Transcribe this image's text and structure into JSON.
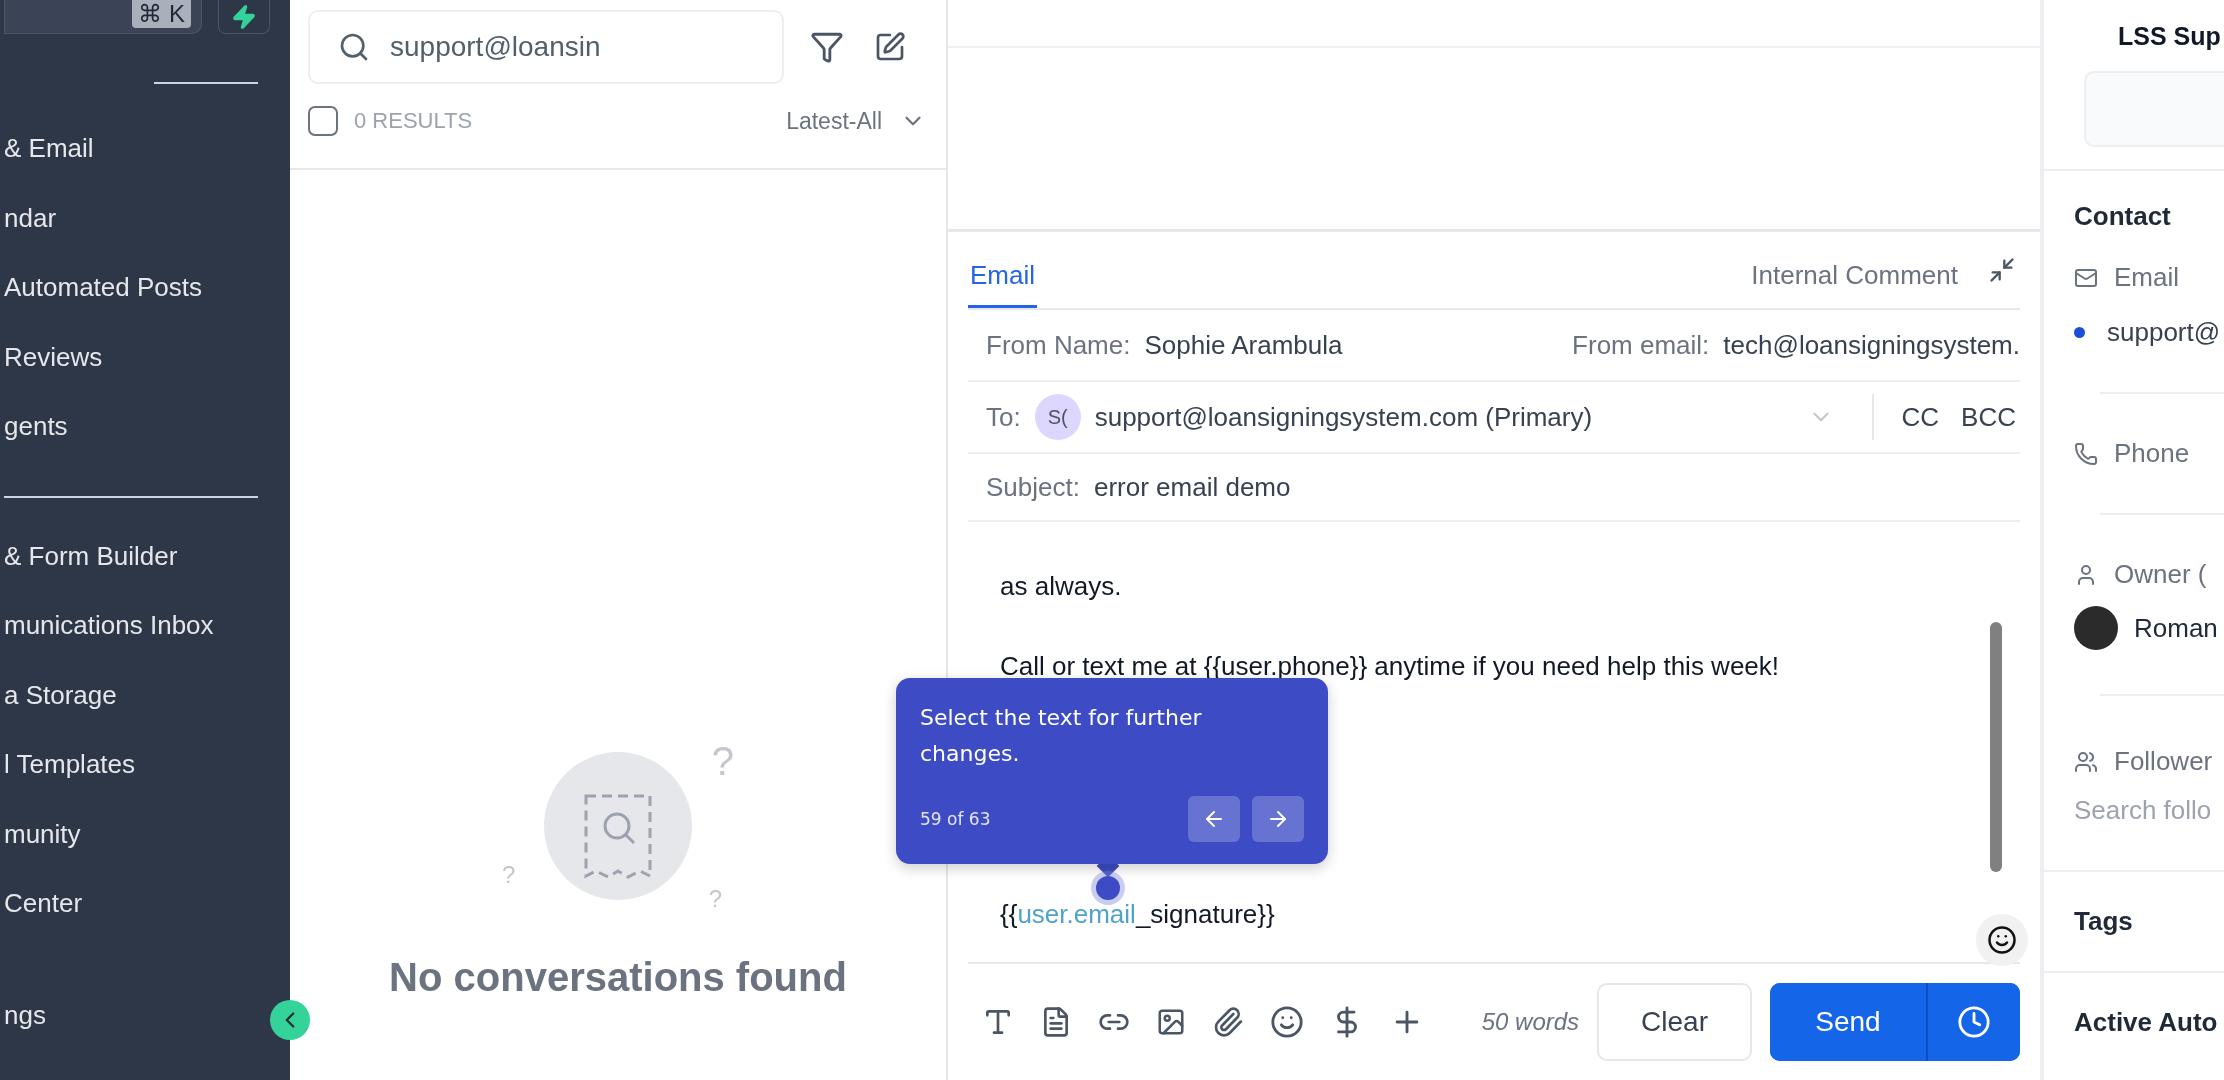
{
  "sidebar": {
    "shortcut": "⌘ K",
    "groups": [
      [
        "& Email",
        "ndar",
        "Automated Posts",
        "Reviews",
        "gents"
      ],
      [
        "& Form Builder",
        "munications Inbox",
        "a Storage",
        "l Templates",
        "munity",
        "Center"
      ],
      [
        "ngs"
      ]
    ]
  },
  "conversations": {
    "search": {
      "value": "support@loansin"
    },
    "select_all": {
      "checked": false
    },
    "results": "0 RESULTS",
    "sort": "Latest-All",
    "empty_marks": [
      "?",
      "?",
      "?"
    ],
    "empty_title": "No conversations found"
  },
  "composer": {
    "tabs": [
      {
        "label": "Email",
        "selected": true
      },
      {
        "label": "Internal Comment",
        "selected": false
      }
    ],
    "from_name_label": "From Name:",
    "from_name": "Sophie Arambula",
    "from_email_label": "From email:",
    "from_email": "tech@loansigningsystem.",
    "to_label": "To:",
    "to_avatar": "S(",
    "to_value": "support@loansigningsystem.com (Primary)",
    "cc": "CC",
    "bcc": "BCC",
    "subject_label": "Subject:",
    "subject": "error email demo",
    "body": [
      "as always.",
      "Call or text me at {{user.phone}} anytime if you need help this week!"
    ],
    "signature": {
      "prefix": "{{",
      "link": "user.email",
      "suffix": "_signature}}"
    },
    "word_count": "50 words",
    "clear": "Clear",
    "send": "Send"
  },
  "tour_tooltip": {
    "text": "Select the text for further changes.",
    "progress": "59 of 63"
  },
  "contact_panel": {
    "title": "LSS Sup",
    "section": "Contact",
    "email_label": "Email",
    "email_value": "support@",
    "phone_label": "Phone",
    "owner_label": "Owner (",
    "owner_name": "Roman",
    "followers_label": "Follower",
    "followers_placeholder": "Search follo",
    "tags": "Tags",
    "automations": "Active Auto"
  }
}
